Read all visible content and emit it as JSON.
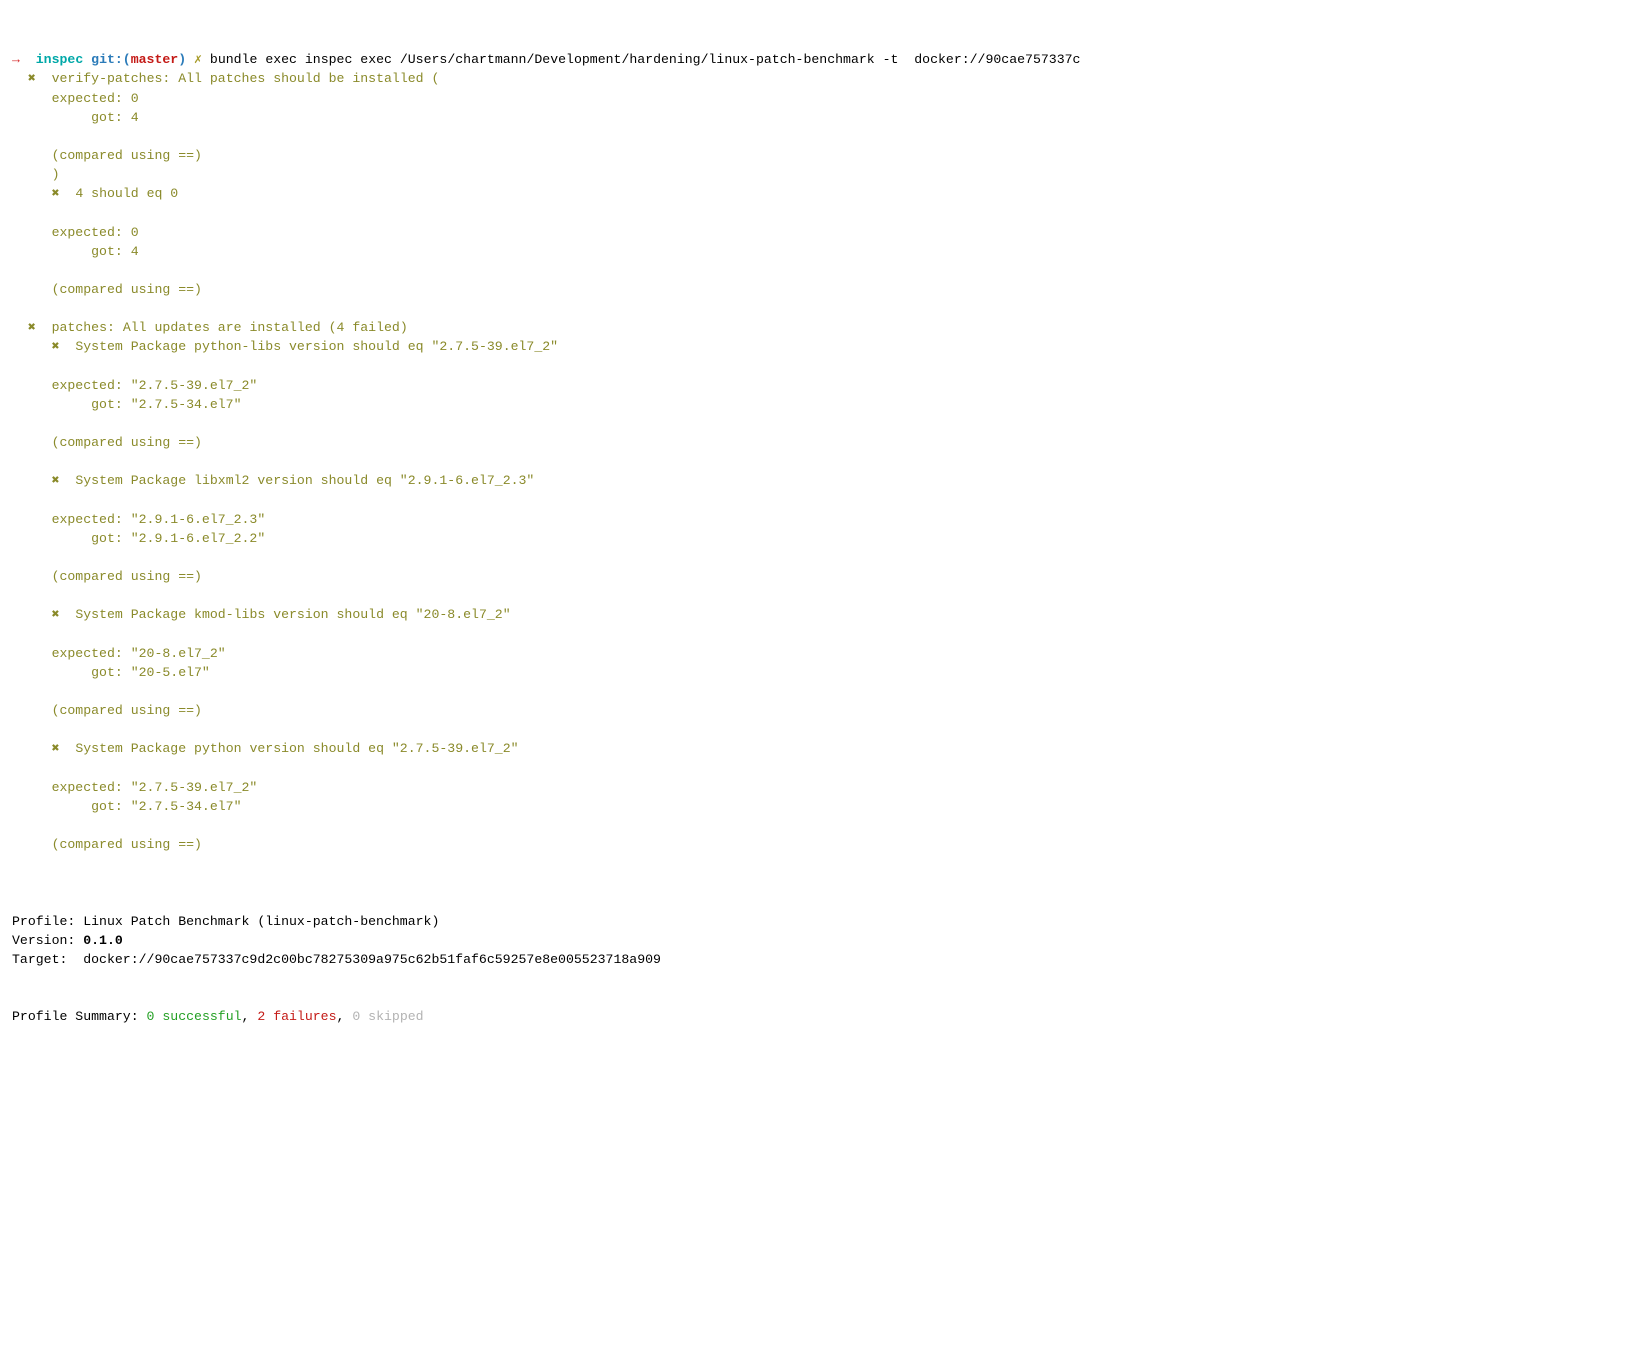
{
  "prompt": {
    "arrow": "→",
    "cwd": "inspec",
    "git_label": "git:(",
    "branch": "master",
    "git_close": ")",
    "dirty": " ✗ ",
    "command": "bundle exec inspec exec /Users/chartmann/Development/hardening/linux-patch-benchmark -t  docker://90cae757337c"
  },
  "section1": {
    "bullet": "  ✖  ",
    "title": "verify-patches: All patches should be installed (",
    "expected": "     expected: 0",
    "got": "          got: 4",
    "compared": "     (compared using ==)",
    "close": "     )",
    "bullet2": "     ✖  ",
    "subtitle": "4 should eq 0",
    "expected2": "     expected: 0",
    "got2": "          got: 4",
    "compared2": "     (compared using ==)"
  },
  "section2": {
    "bullet": "  ✖  ",
    "title": "patches: All updates are installed (4 failed)",
    "items": [
      {
        "bullet": "     ✖  ",
        "line": "System Package python-libs version should eq \"2.7.5-39.el7_2\"",
        "expected": "     expected: \"2.7.5-39.el7_2\"",
        "got": "          got: \"2.7.5-34.el7\"",
        "compared": "     (compared using ==)"
      },
      {
        "bullet": "     ✖  ",
        "line": "System Package libxml2 version should eq \"2.9.1-6.el7_2.3\"",
        "expected": "     expected: \"2.9.1-6.el7_2.3\"",
        "got": "          got: \"2.9.1-6.el7_2.2\"",
        "compared": "     (compared using ==)"
      },
      {
        "bullet": "     ✖  ",
        "line": "System Package kmod-libs version should eq \"20-8.el7_2\"",
        "expected": "     expected: \"20-8.el7_2\"",
        "got": "          got: \"20-5.el7\"",
        "compared": "     (compared using ==)"
      },
      {
        "bullet": "     ✖  ",
        "line": "System Package python version should eq \"2.7.5-39.el7_2\"",
        "expected": "     expected: \"2.7.5-39.el7_2\"",
        "got": "          got: \"2.7.5-34.el7\"",
        "compared": "     (compared using ==)"
      }
    ]
  },
  "profile": {
    "line1_label": "Profile: ",
    "line1_value": "Linux Patch Benchmark (linux-patch-benchmark)",
    "line2_label": "Version: ",
    "line2_value": "0.1.0",
    "line3_label": "Target:  ",
    "line3_value": "docker://90cae757337c9d2c00bc78275309a975c62b51faf6c59257e8e005523718a909"
  },
  "summary": {
    "prefix": "Profile Summary: ",
    "success_n": "0",
    "success_word": " successful",
    "comma1": ", ",
    "fail_n": "2",
    "fail_word": " failures",
    "comma2": ", ",
    "skip_n": "0",
    "skip_word": " skipped"
  }
}
